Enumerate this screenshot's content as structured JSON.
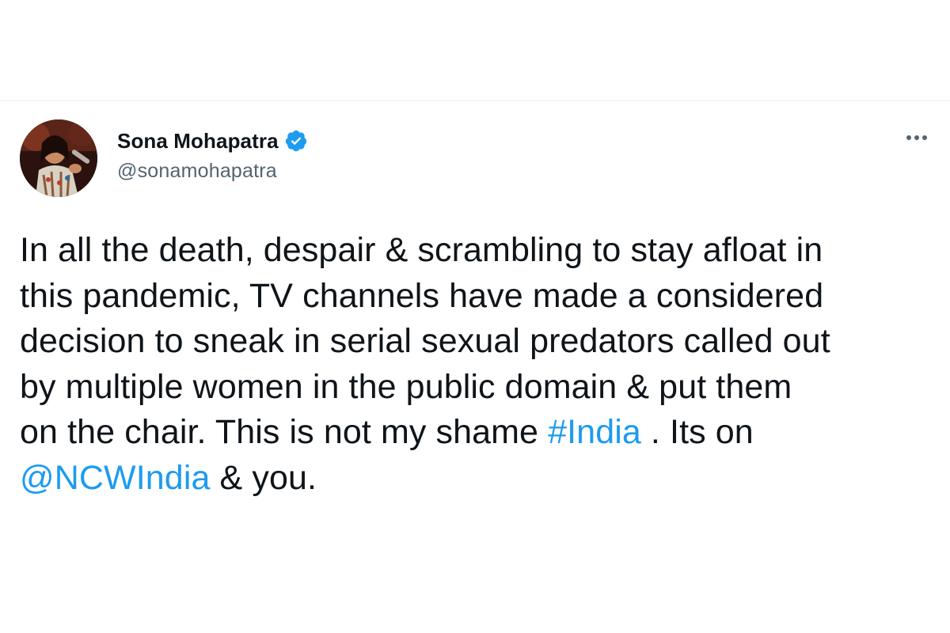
{
  "author": {
    "display_name": "Sona Mohapatra",
    "handle": "@sonamohapatra",
    "verified_icon": "verified-badge-icon"
  },
  "more_icon": "more-horizontal-icon",
  "colors": {
    "link": "#1d9bf0",
    "text": "#0f1419",
    "secondary": "#536471",
    "verified": "#1d9bf0"
  },
  "tweet": {
    "line1": "In all the death, despair & scrambling to stay afloat in",
    "line2": "this pandemic, TV channels have made a considered",
    "line3": "decision to sneak in serial sexual predators called out",
    "line4": "by multiple women in the public domain & put them",
    "line5_prefix": "on the chair. This is not my shame ",
    "hashtag": "#India",
    "line5_suffix": " . Its on",
    "mention": "@NCWIndia",
    "line6_suffix": " & you."
  }
}
